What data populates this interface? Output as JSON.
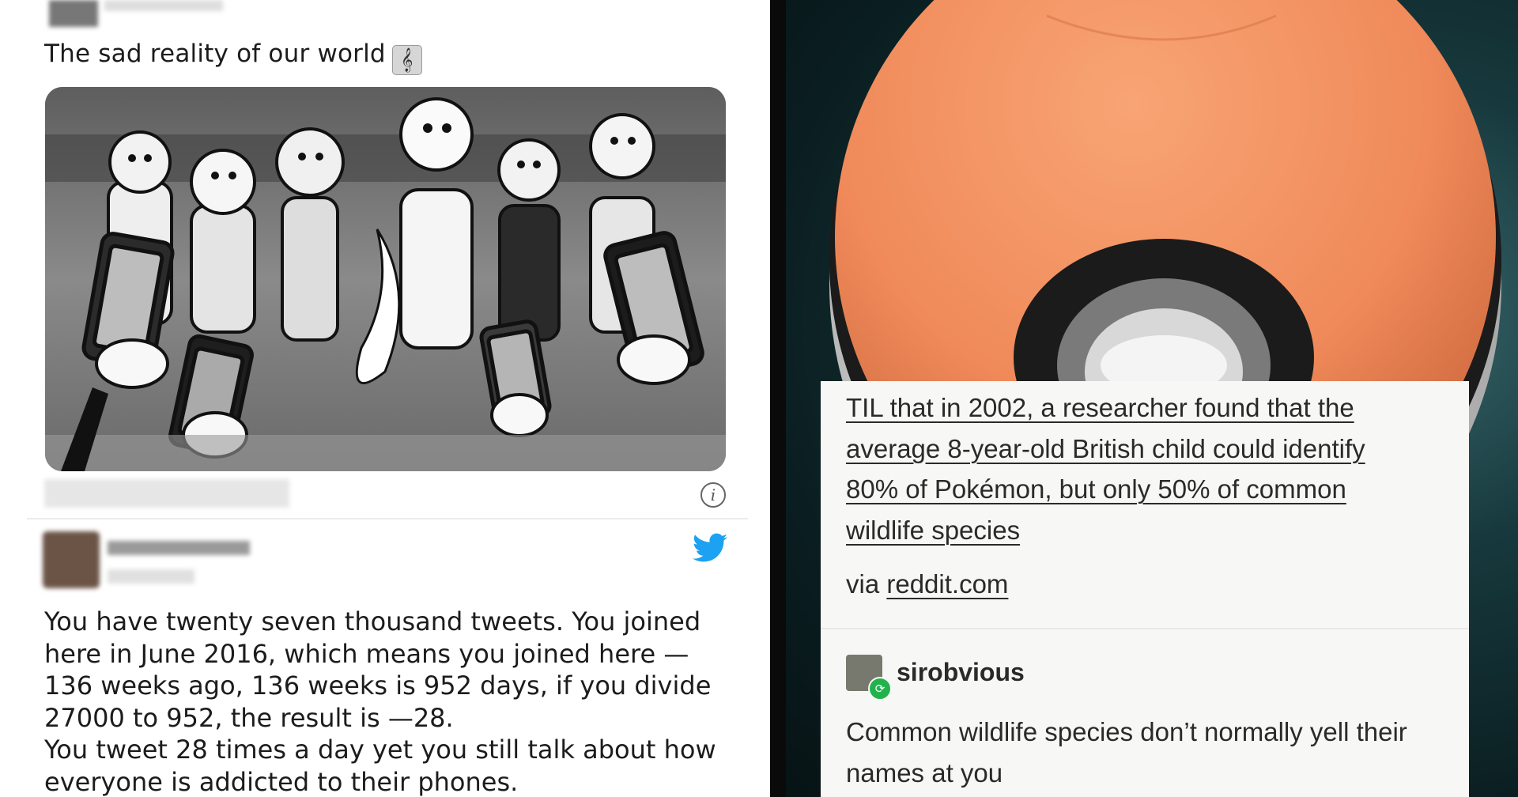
{
  "left_panel": {
    "tweet1": {
      "text": "The sad reality of our world",
      "emoji_icon": "musical-score-icon",
      "emoji_glyph": "𝄞"
    },
    "tweet2": {
      "lines": [
        "You have twenty seven thousand tweets. You joined",
        "here in June 2016, which means you joined here —",
        "136 weeks ago, 136 weeks is 952 days, if you divide",
        "27000 to 952, the result is —28.",
        "You tweet 28 times a day yet you still talk about how",
        "everyone is addicted to their phones."
      ],
      "brand_icon": "twitter-bird-icon",
      "brand_color": "#1da1f2"
    },
    "info_glyph": "i"
  },
  "right_panel": {
    "post": {
      "lines": [
        "TIL that in 2002, a researcher found that the",
        "average 8-year-old British child could identify",
        "80% of Pokémon, but only 50% of common",
        "wildlife species"
      ],
      "via_prefix": "via",
      "via_link": "reddit.com"
    },
    "reblog": {
      "username": "sirobvious",
      "badge_glyph": "⟳",
      "lines": [
        "Common wildlife species don’t normally yell their",
        "names at you"
      ]
    },
    "pokeball_colors": {
      "top": "#f08a5a",
      "band": "#1b1b1b",
      "bottom": "#dedede"
    }
  }
}
